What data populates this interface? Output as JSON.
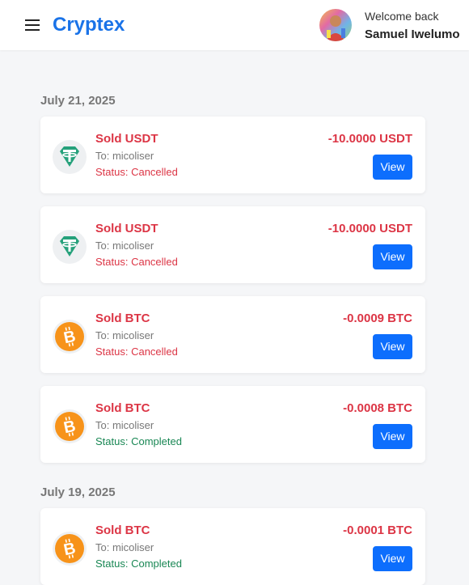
{
  "header": {
    "brand": "Cryptex",
    "welcome_text": "Welcome back",
    "user_name": "Samuel Iwelumo"
  },
  "colors": {
    "brand": "#1a73e8",
    "negative": "#dc3545",
    "cancelled": "#dc3545",
    "completed": "#198754",
    "button": "#0d6efd",
    "usdt": "#26a17b",
    "btc": "#f7931a"
  },
  "groups": [
    {
      "date": "July 21, 2025",
      "transactions": [
        {
          "icon": "usdt-icon",
          "title": "Sold USDT",
          "to": "To: micoliser",
          "status": "Status: Cancelled",
          "state": "cancelled",
          "amount": "-10.0000 USDT",
          "action": "View"
        },
        {
          "icon": "usdt-icon",
          "title": "Sold USDT",
          "to": "To: micoliser",
          "status": "Status: Cancelled",
          "state": "cancelled",
          "amount": "-10.0000 USDT",
          "action": "View"
        },
        {
          "icon": "btc-icon",
          "title": "Sold BTC",
          "to": "To: micoliser",
          "status": "Status: Cancelled",
          "state": "cancelled",
          "amount": "-0.0009 BTC",
          "action": "View"
        },
        {
          "icon": "btc-icon",
          "title": "Sold BTC",
          "to": "To: micoliser",
          "status": "Status: Completed",
          "state": "completed",
          "amount": "-0.0008 BTC",
          "action": "View"
        }
      ]
    },
    {
      "date": "July 19, 2025",
      "transactions": [
        {
          "icon": "btc-icon",
          "title": "Sold BTC",
          "to": "To: micoliser",
          "status": "Status: Completed",
          "state": "completed",
          "amount": "-0.0001 BTC",
          "action": "View"
        }
      ]
    }
  ]
}
